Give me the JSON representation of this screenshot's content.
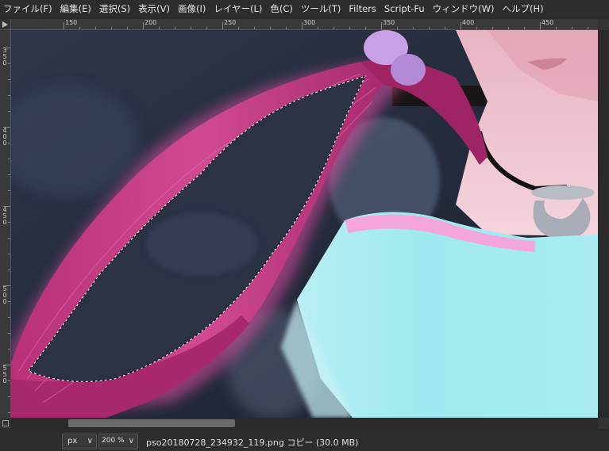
{
  "menubar": {
    "items": [
      "ファイル(F)",
      "編集(E)",
      "選択(S)",
      "表示(V)",
      "画像(I)",
      "レイヤー(L)",
      "色(C)",
      "ツール(T)",
      "Filters",
      "Script-Fu",
      "ウィンドウ(W)",
      "ヘルプ(H)"
    ]
  },
  "ruler": {
    "h_labels": [
      "150",
      "200",
      "250",
      "300",
      "350",
      "400",
      "450"
    ],
    "v_labels": [
      "350",
      "400",
      "450",
      "500",
      "550"
    ]
  },
  "statusbar": {
    "unit": "px",
    "zoom": "200 %",
    "file_info": "pso20180728_234932_119.png コピー (30.0 MB)"
  },
  "colors": {
    "hair": "#c0397f",
    "shirt": "#9feaf0",
    "collar": "#f7a8da",
    "skin": "#f2c8d0",
    "background": "#2a3448"
  }
}
